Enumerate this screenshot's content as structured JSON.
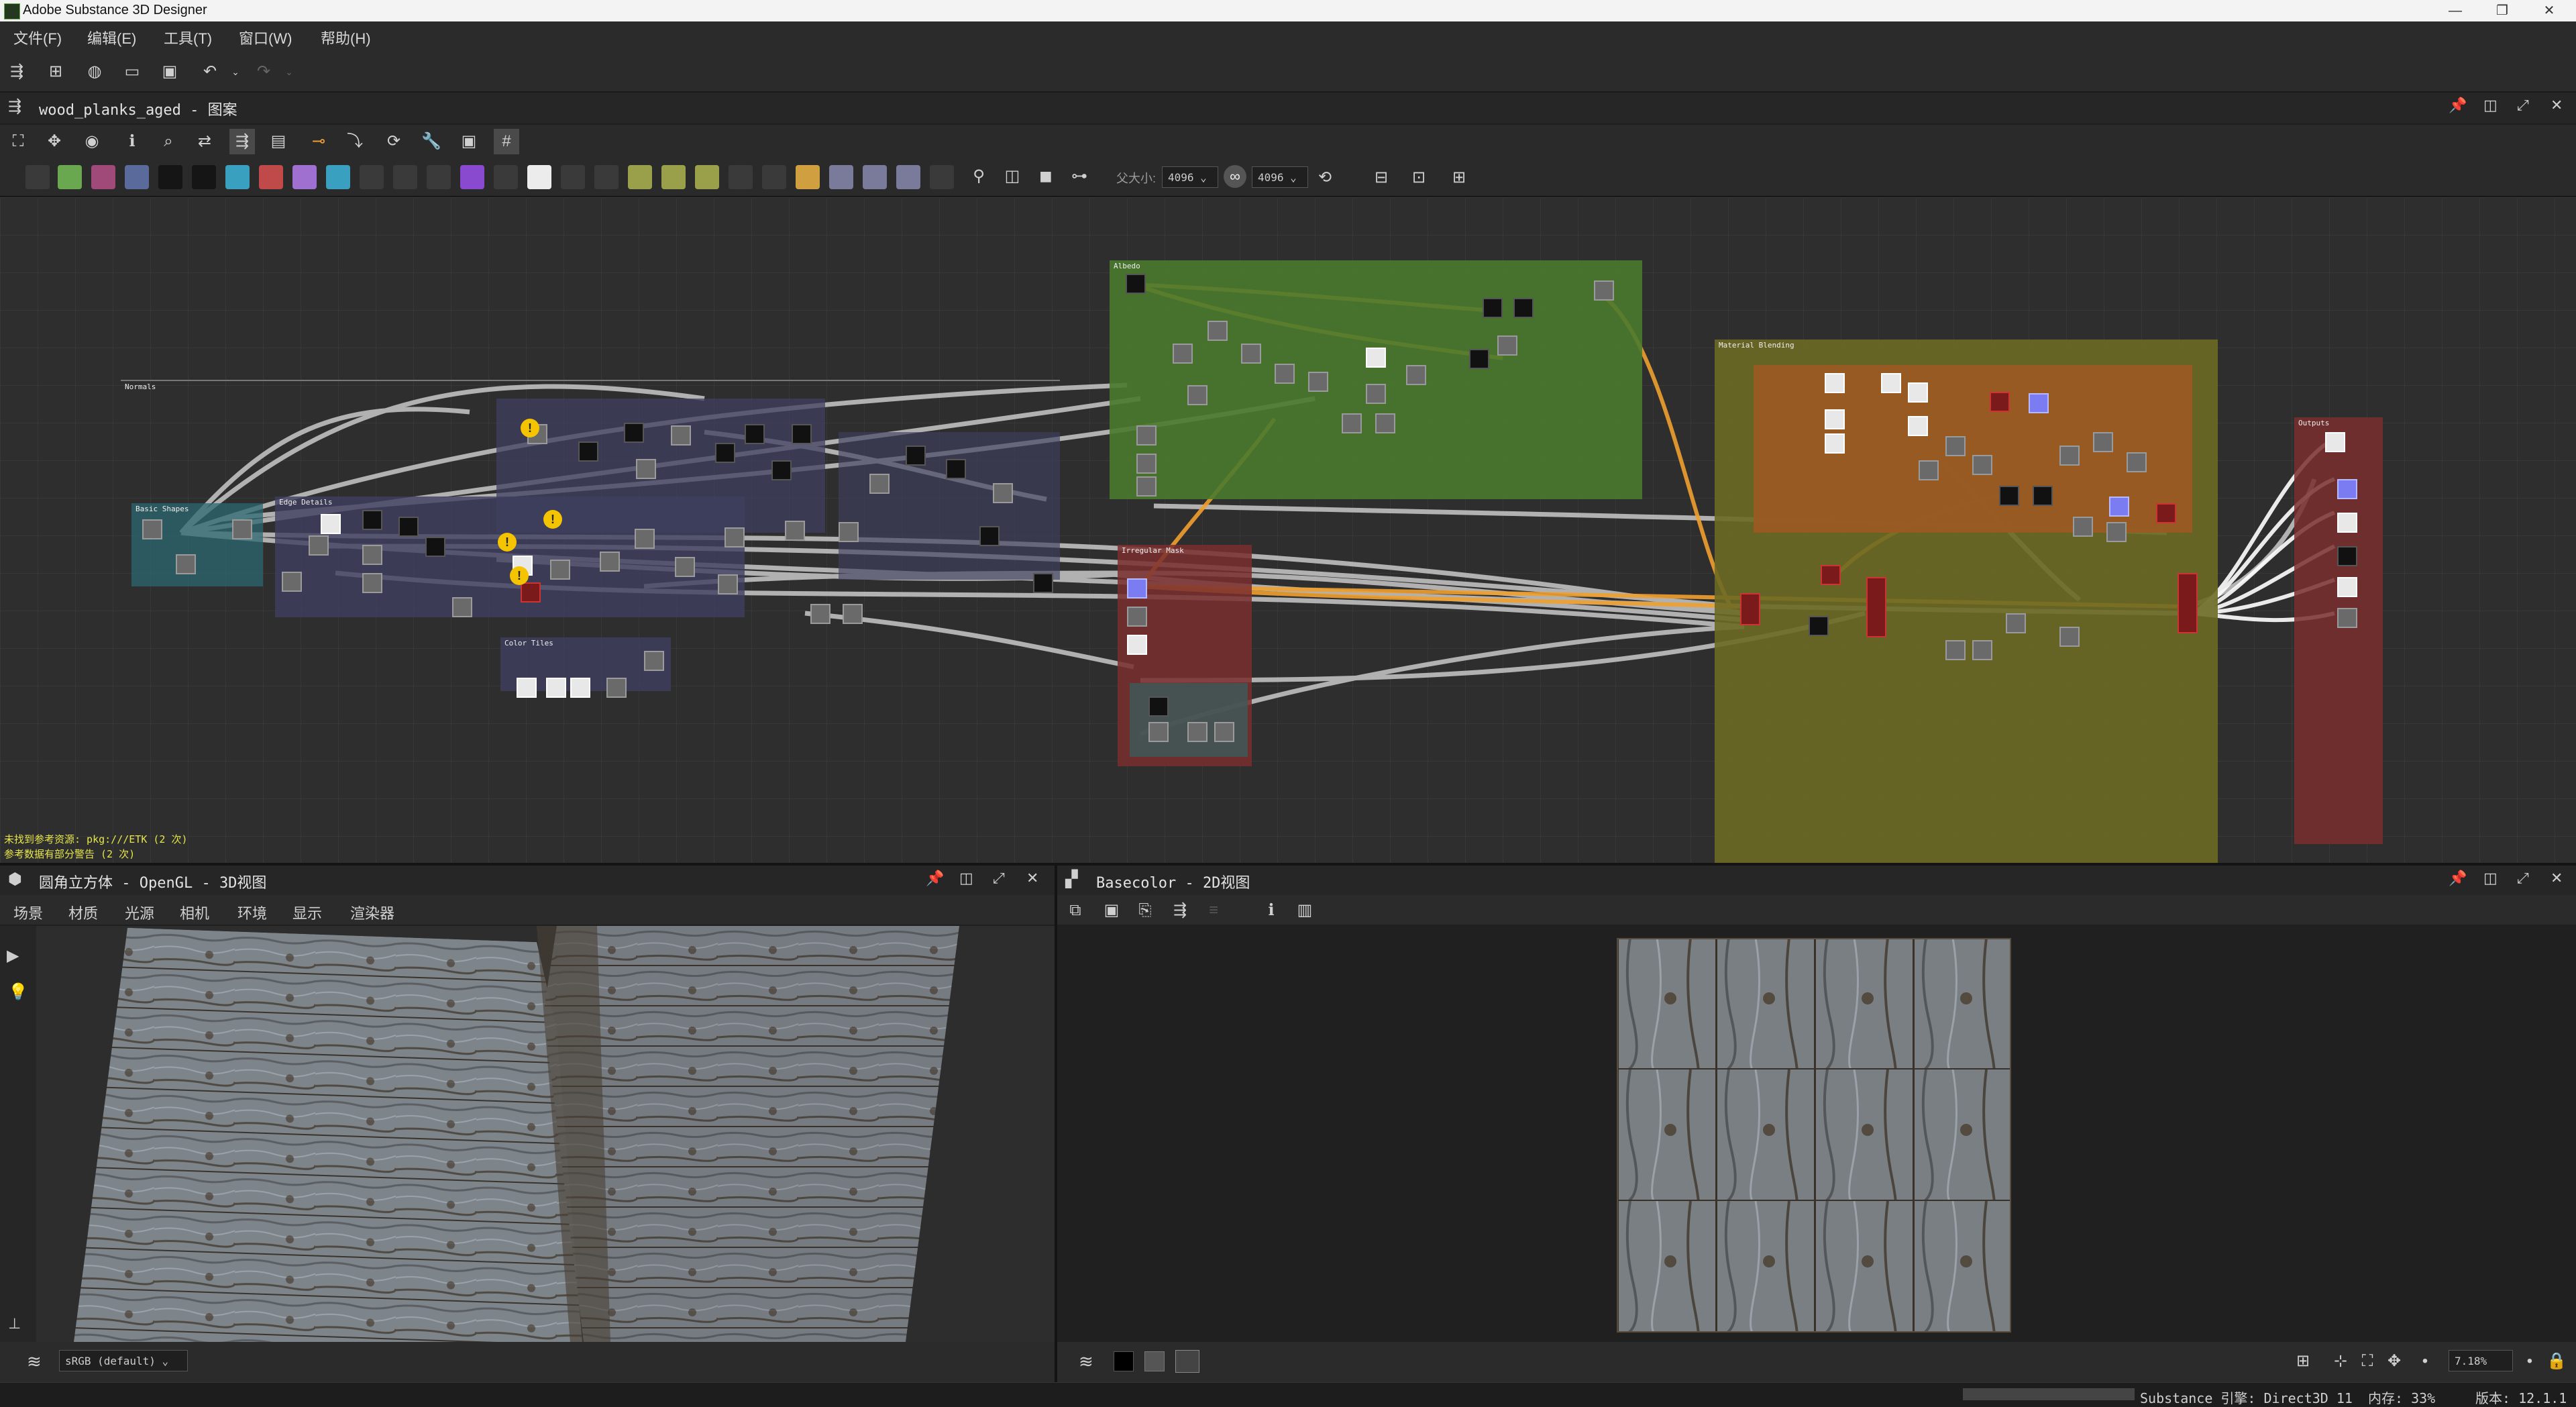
{
  "window": {
    "title": "Adobe Substance 3D Designer",
    "minimize": "—",
    "restore": "❐",
    "close": "✕"
  },
  "menu": [
    "文件(F)",
    "编辑(E)",
    "工具(T)",
    "窗口(W)",
    "帮助(H)"
  ],
  "graph": {
    "title": "wood_planks_aged - 图案",
    "parent_size_label": "父大小:",
    "width_value": "4096",
    "height_value": "4096",
    "frames": [
      {
        "title": "Normals"
      },
      {
        "title": "Basic Shapes"
      },
      {
        "title": "Edge Details"
      },
      {
        "title": "Color Tiles"
      },
      {
        "title": "Albedo"
      },
      {
        "title": "Irregular Mask"
      },
      {
        "title": "Material Blending"
      },
      {
        "title": "Outputs"
      }
    ],
    "warnings": [
      "未找到参考资源: pkg:///ETK (2 次)",
      "参考数据有部分警告 (2 次)"
    ]
  },
  "panel3d": {
    "title": "圆角立方体 - OpenGL - 3D视图",
    "tabs": [
      "场景",
      "材质",
      "光源",
      "相机",
      "环境",
      "显示",
      "渲染器"
    ],
    "colorspace": "sRGB (default)"
  },
  "panel2d": {
    "title": "Basecolor - 2D视图",
    "zoom": "7.18%"
  },
  "status": {
    "engine": "Substance 引擎: Direct3D 11",
    "memory": "内存: 33%",
    "version": "版本: 12.1.1"
  },
  "colors": {
    "frame_green": "#4a7a2d",
    "frame_orange": "#9a5a23",
    "frame_olive": "#6d6a24",
    "frame_red": "#7a2e2e",
    "frame_purple": "#3f3f5f",
    "frame_teal": "#2c6870",
    "wire_orange": "#f0a030",
    "wire_gray": "#c8c8c8"
  }
}
